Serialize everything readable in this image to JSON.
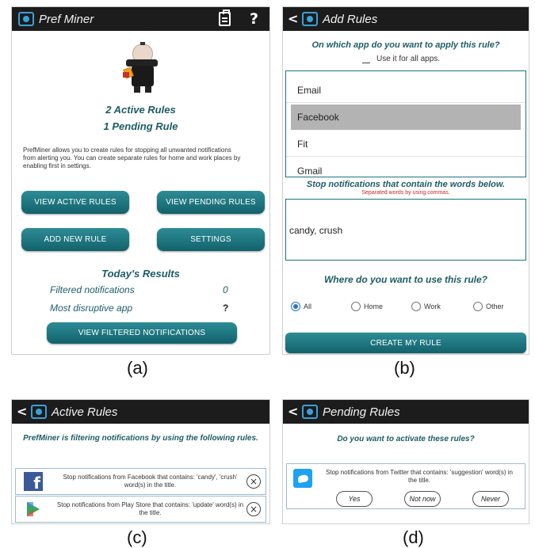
{
  "colors": {
    "teal": "#1b5c66",
    "button": "#1a7480",
    "appbar": "#1c1c1c",
    "accent": "#3aa0d8",
    "red": "#d32020",
    "facebook": "#3b5998",
    "twitter": "#1da1f2"
  },
  "panel_a": {
    "app_title": "Pref Miner",
    "help_label": "?",
    "active_rules": "2 Active Rules",
    "pending_rule": "1 Pending Rule",
    "description": "PrefMiner allows you to create rules for stopping all unwanted notifications from alerting you. You can create separate rules for home and work places by enabling first in settings.",
    "view_active_btn": "VIEW ACTIVE RULES",
    "view_pending_btn": "VIEW PENDING RULES",
    "add_rule_btn": "ADD NEW RULE",
    "settings_btn": "SETTINGS",
    "results_title": "Today's Results",
    "filtered_label": "Filtered notifications",
    "filtered_value": "0",
    "disruptive_label": "Most disruptive app",
    "disruptive_value": "?",
    "view_filtered_btn": "VIEW FILTERED NOTIFICATIONS",
    "caption": "(a)"
  },
  "panel_b": {
    "title": "Add Rules",
    "question_app": "On which app do you want to apply this rule?",
    "use_all_label": "Use it for all apps.",
    "apps": [
      "Email",
      "Facebook",
      "Fit",
      "Gmail"
    ],
    "question_words": "Stop notifications that contain the words below.",
    "hint": "Separated words by using commas.",
    "words_value": "candy, crush",
    "question_where": "Where do you want to use this rule?",
    "places": [
      "All",
      "Home",
      "Work",
      "Other"
    ],
    "create_btn": "CREATE MY RULE",
    "caption": "(b)"
  },
  "panel_c": {
    "title": "Active Rules",
    "header": "PrefMiner is filtering notifications by using the following rules.",
    "rules": [
      {
        "text": "Stop notifications from Facebook that contains: 'candy', 'crush' word(s) in the title.",
        "icon": "facebook-icon"
      },
      {
        "text": "Stop notifications from Play Store that contains: 'update' word(s) in the title.",
        "icon": "play-store-icon"
      }
    ],
    "close_symbol": "×",
    "caption": "(c)"
  },
  "panel_d": {
    "title": "Pending Rules",
    "question": "Do you want to activate these rules?",
    "rule_text": "Stop notifications from Twitter that contains: 'suggestion' word(s) in the title.",
    "yes_btn": "Yes",
    "not_now_btn": "Not now",
    "never_btn": "Never",
    "caption": "(d)"
  }
}
